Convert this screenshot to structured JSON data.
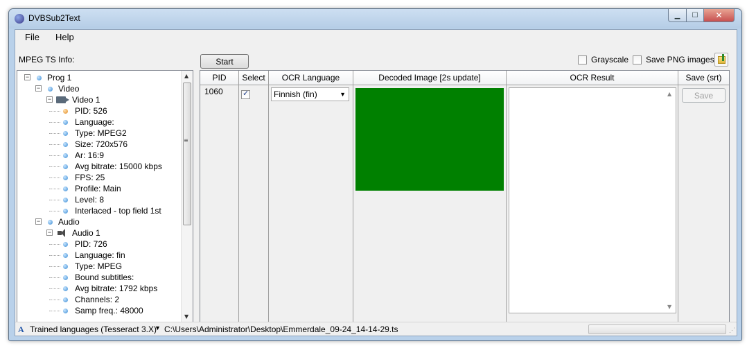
{
  "window": {
    "title": "DVBSub2Text",
    "controls": {
      "minimize": "▁",
      "maximize": "☐",
      "close": "✕"
    }
  },
  "menu": {
    "items": [
      "File",
      "Help"
    ]
  },
  "toolbar": {
    "mpeg_label": "MPEG TS Info:",
    "start_label": "Start",
    "grayscale_label": "Grayscale",
    "grayscale_checked": false,
    "save_png_label": "Save PNG images",
    "save_png_checked": false
  },
  "tree": {
    "nodes": [
      {
        "label": "Prog 1",
        "level": 0,
        "expander": "−",
        "icon": "dot"
      },
      {
        "label": "Video",
        "level": 1,
        "expander": "−",
        "icon": "dot"
      },
      {
        "label": "Video 1",
        "level": 2,
        "expander": "−",
        "icon": "video"
      },
      {
        "label": "PID: 526",
        "level": 3,
        "icon": "orange-dot"
      },
      {
        "label": "Language:",
        "level": 3,
        "icon": "dot"
      },
      {
        "label": "Type: MPEG2",
        "level": 3,
        "icon": "dot"
      },
      {
        "label": "Size: 720x576",
        "level": 3,
        "icon": "dot"
      },
      {
        "label": "Ar: 16:9",
        "level": 3,
        "icon": "dot"
      },
      {
        "label": "Avg bitrate: 15000 kbps",
        "level": 3,
        "icon": "dot"
      },
      {
        "label": "FPS: 25",
        "level": 3,
        "icon": "dot"
      },
      {
        "label": "Profile: Main",
        "level": 3,
        "icon": "dot"
      },
      {
        "label": "Level: 8",
        "level": 3,
        "icon": "dot"
      },
      {
        "label": "Interlaced - top field 1st",
        "level": 3,
        "icon": "dot"
      },
      {
        "label": "Audio",
        "level": 1,
        "expander": "−",
        "icon": "dot"
      },
      {
        "label": "Audio 1",
        "level": 2,
        "expander": "−",
        "icon": "audio"
      },
      {
        "label": "PID: 726",
        "level": 3,
        "icon": "dot"
      },
      {
        "label": "Language: fin",
        "level": 3,
        "icon": "dot"
      },
      {
        "label": "Type: MPEG",
        "level": 3,
        "icon": "dot"
      },
      {
        "label": "Bound subtitles:",
        "level": 3,
        "icon": "dot"
      },
      {
        "label": "Avg bitrate: 1792 kbps",
        "level": 3,
        "icon": "dot"
      },
      {
        "label": "Channels: 2",
        "level": 3,
        "icon": "dot"
      },
      {
        "label": "Samp freq.: 48000",
        "level": 3,
        "icon": "dot"
      }
    ]
  },
  "grid": {
    "columns": {
      "pid": "PID",
      "select": "Select",
      "ocr_language": "OCR Language",
      "decoded_image": "Decoded Image [2s update]",
      "ocr_result": "OCR Result",
      "save": "Save (srt)"
    },
    "row": {
      "pid": "1060",
      "selected": true,
      "ocr_language": "Finnish (fin)",
      "decoded_color": "#008000",
      "ocr_result": "",
      "save_label": "Save"
    }
  },
  "statusbar": {
    "trained_languages": "Trained languages (Tesseract 3.X)",
    "file_path": "C:\\Users\\Administrator\\Desktop\\Emmerdale_09-24_14-14-29.ts",
    "progress": 0
  }
}
